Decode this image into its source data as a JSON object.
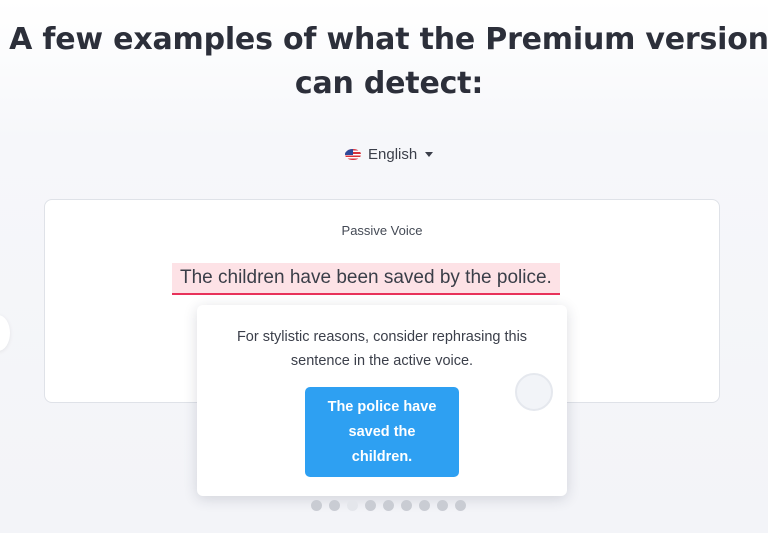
{
  "headline": {
    "line1": "A few examples of what the Premium version",
    "line2": "can detect:"
  },
  "language_selector": {
    "label": "English",
    "flag_icon": "us-flag-icon"
  },
  "example_card": {
    "category": "Passive Voice",
    "sentence": "The children have been saved by the police.",
    "highlight_color": "#fde2e6",
    "underline_color": "#e8325a"
  },
  "suggestion_popup": {
    "message": "For stylistic reasons, consider rephrasing this sentence in the active voice.",
    "suggestion_label": "The police have saved the children.",
    "button_color": "#2ea0f2"
  },
  "carousel": {
    "dot_count": 9,
    "active_index": 2
  }
}
